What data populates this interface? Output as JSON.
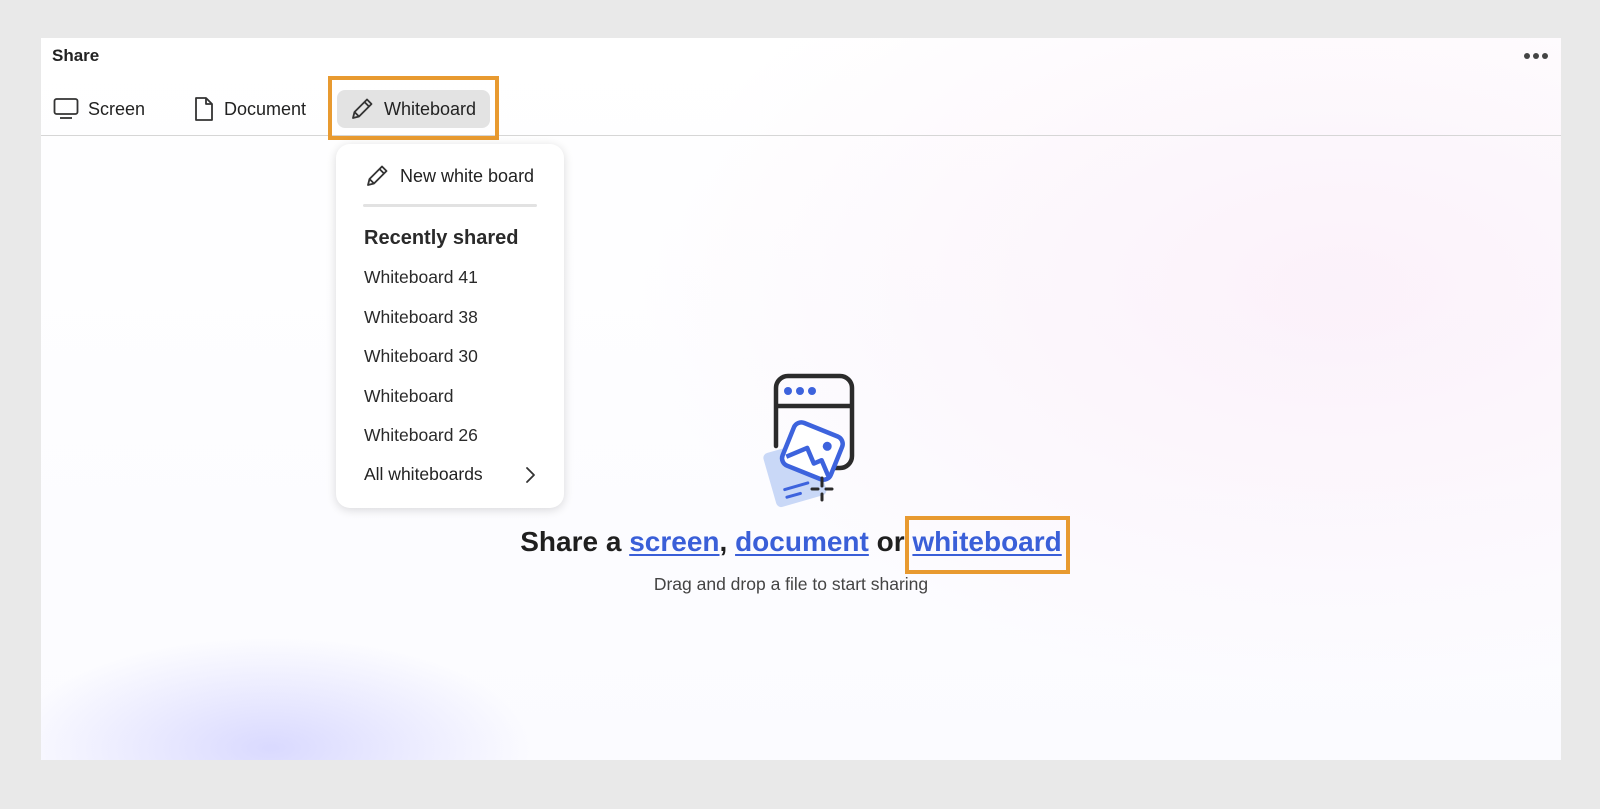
{
  "panel": {
    "title": "Share",
    "more_icon": "more-horizontal-icon"
  },
  "tabs": [
    {
      "label": "Screen",
      "icon": "monitor-icon"
    },
    {
      "label": "Document",
      "icon": "document-icon"
    },
    {
      "label": "Whiteboard",
      "icon": "pencil-icon",
      "selected": true
    }
  ],
  "dropdown": {
    "new_label": "New white board",
    "new_icon": "pencil-icon",
    "heading": "Recently shared",
    "items": [
      "Whiteboard 41",
      "Whiteboard 38",
      "Whiteboard 30",
      "Whiteboard",
      "Whiteboard 26"
    ],
    "all_label": "All whiteboards",
    "all_icon": "chevron-right-icon"
  },
  "hero": {
    "prefix": "Share a ",
    "screen_link": "screen",
    "comma": ",",
    "document_link": "document",
    "or": "or",
    "whiteboard_link": "whiteboard",
    "subtitle": "Drag and drop a file to start sharing",
    "illustration_icon": "share-window-image-icon"
  },
  "colors": {
    "accent_link": "#3a5fd8",
    "highlight_outline": "#e89a30",
    "illustration_blue": "#3d63dd",
    "illustration_light_blue": "#c9d8f7"
  }
}
